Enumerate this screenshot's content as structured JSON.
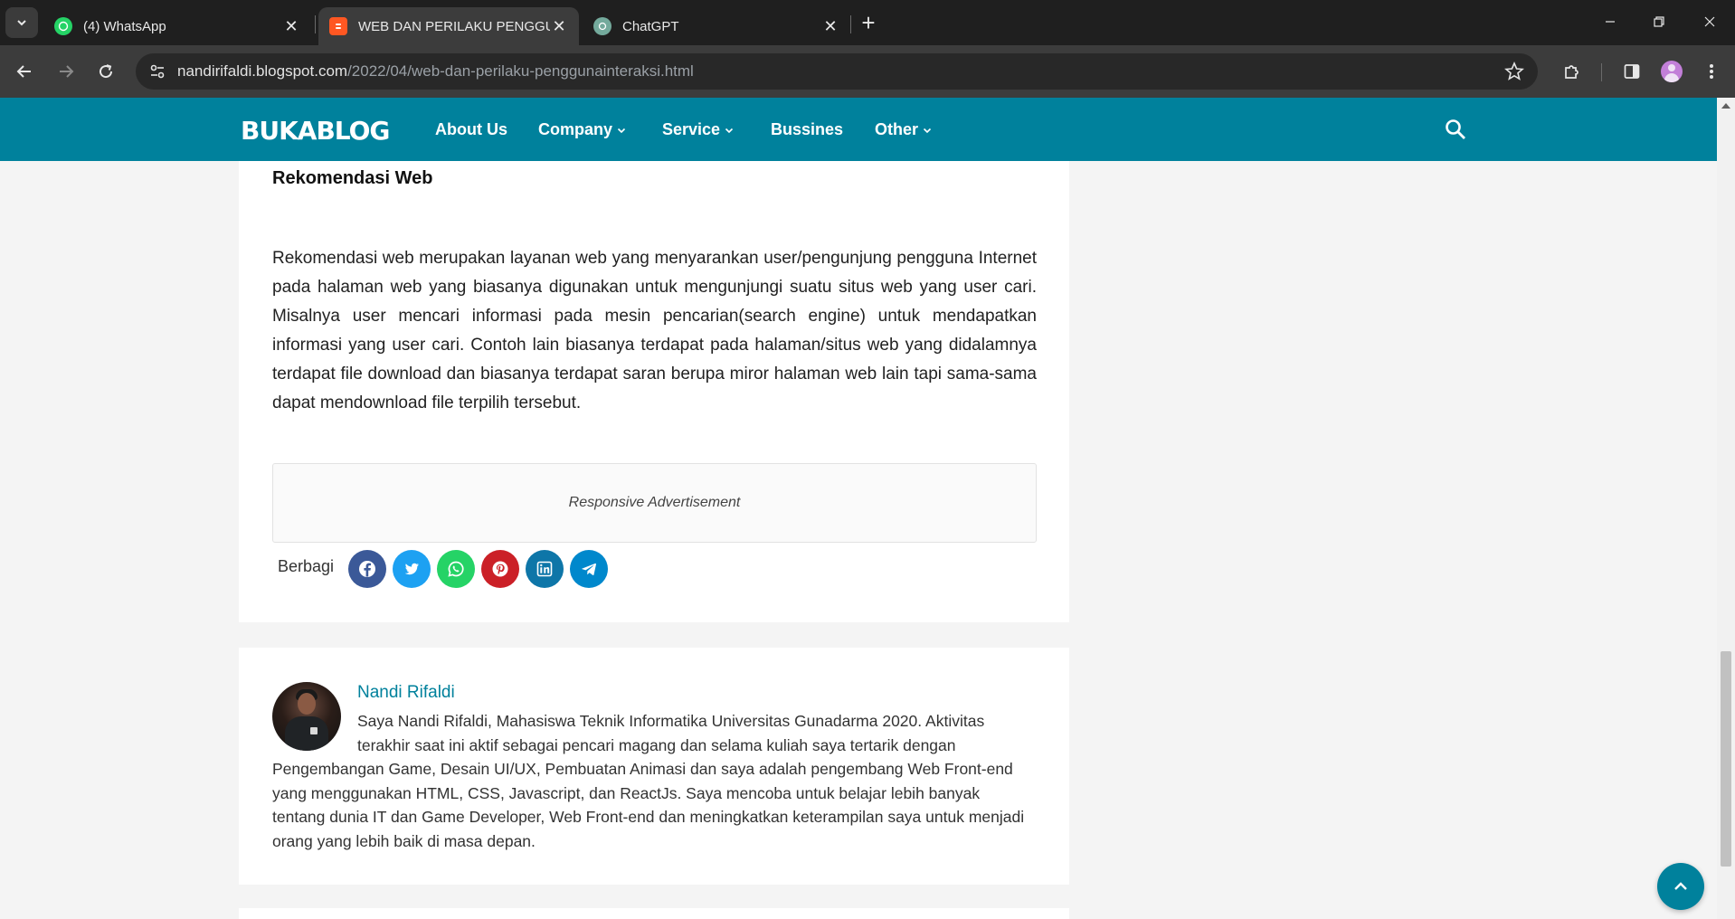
{
  "browser": {
    "tabs": [
      {
        "title": "(4) WhatsApp",
        "icon": "whatsapp-icon"
      },
      {
        "title": "WEB DAN PERILAKU PENGGUNA",
        "icon": "blogger-icon"
      },
      {
        "title": "ChatGPT",
        "icon": "chatgpt-icon"
      }
    ],
    "url_host": "nandirifaldi.blogspot.com",
    "url_path": "/2022/04/web-dan-perilaku-penggunainteraksi.html"
  },
  "site": {
    "logo": "BUKABLOG",
    "nav": [
      {
        "label": "About Us",
        "has_dropdown": false
      },
      {
        "label": "Company",
        "has_dropdown": true
      },
      {
        "label": "Service",
        "has_dropdown": true
      },
      {
        "label": "Bussines",
        "has_dropdown": false
      },
      {
        "label": "Other",
        "has_dropdown": true
      }
    ],
    "brand_color": "#00819c"
  },
  "article": {
    "section_title": "Rekomendasi Web",
    "body": "Rekomendasi web merupakan layanan web yang menyarankan user/pengunjung pengguna Internet pada halaman web yang biasanya digunakan untuk mengunjungi suatu situs web yang user cari. Misalnya user mencari informasi pada mesin pencarian(search engine) untuk mendapatkan informasi yang user cari. Contoh lain biasanya terdapat pada halaman/situs web yang didalamnya terdapat file download dan biasanya terdapat saran berupa miror halaman web lain tapi sama-sama dapat mendownload file terpilih tersebut.",
    "ad_label": "Responsive Advertisement",
    "share_label": "Berbagi",
    "share_buttons": [
      {
        "network": "facebook",
        "icon": "facebook-icon",
        "color": "#3b5998"
      },
      {
        "network": "twitter",
        "icon": "twitter-icon",
        "color": "#1da1f2"
      },
      {
        "network": "whatsapp",
        "icon": "whatsapp-icon",
        "color": "#25d366"
      },
      {
        "network": "pinterest",
        "icon": "pinterest-icon",
        "color": "#cb2027"
      },
      {
        "network": "linkedin",
        "icon": "linkedin-icon",
        "color": "#0e76a8"
      },
      {
        "network": "telegram",
        "icon": "telegram-icon",
        "color": "#0088cc"
      }
    ]
  },
  "author": {
    "name": "Nandi Rifaldi",
    "bio": "Saya Nandi Rifaldi, Mahasiswa Teknik Informatika Universitas Gunadarma 2020. Aktivitas terakhir saat ini aktif sebagai pencari magang dan selama kuliah saya tertarik dengan Pengembangan Game, Desain UI/UX, Pembuatan Animasi dan saya adalah pengembang Web Front-end yang menggunakan HTML, CSS, Javascript, dan ReactJs. Saya mencoba untuk belajar lebih banyak tentang dunia IT dan Game Developer, Web Front-end dan meningkatkan keterampilan saya untuk menjadi orang yang lebih baik di masa depan."
  }
}
